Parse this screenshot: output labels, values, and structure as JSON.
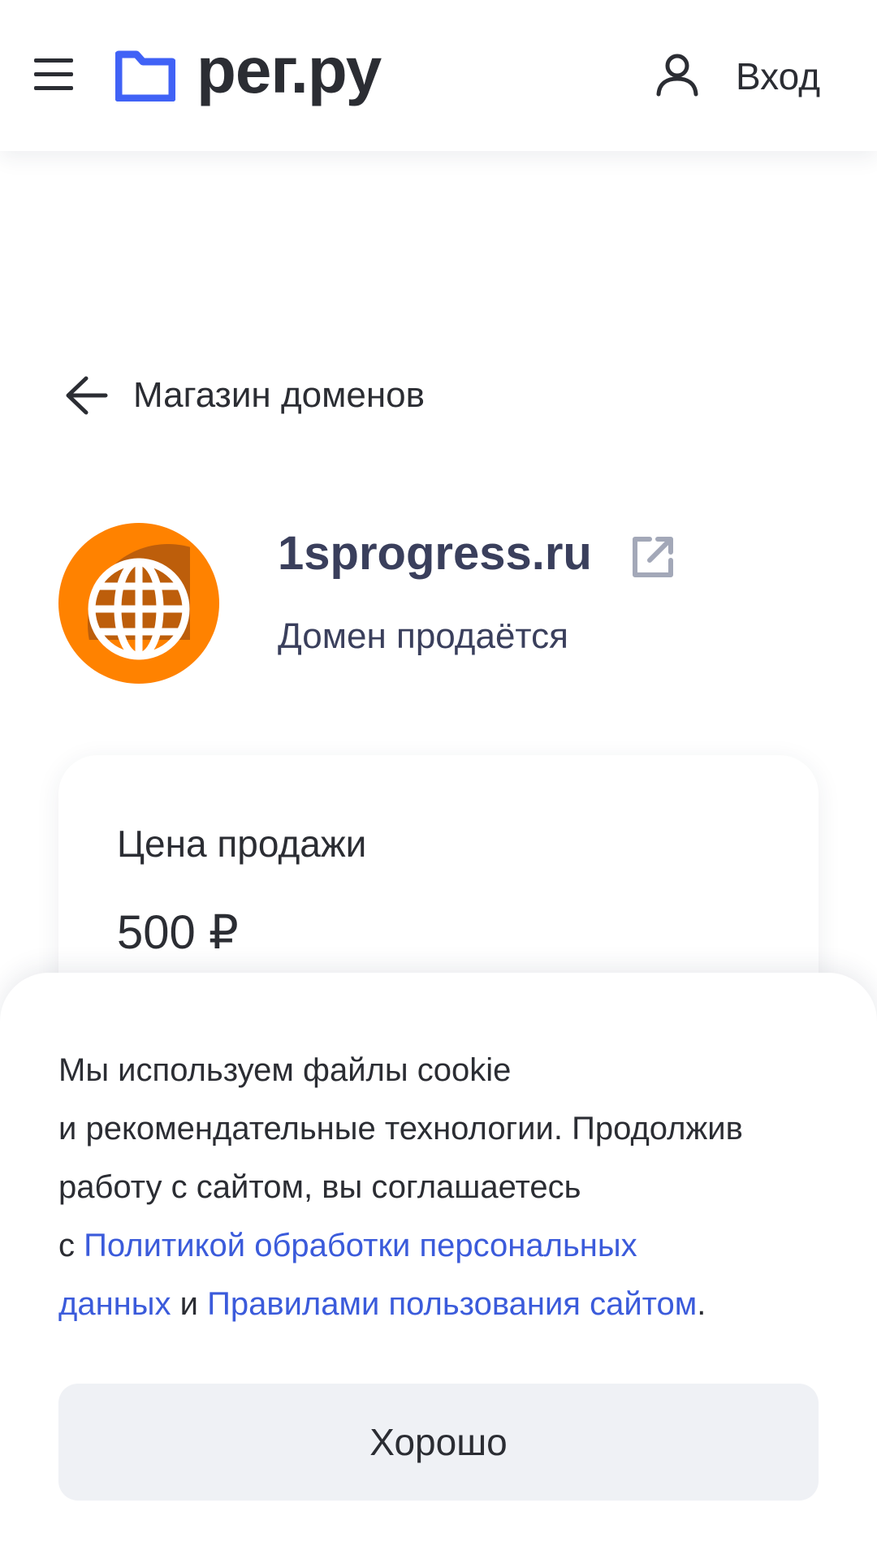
{
  "header": {
    "logo_text": "рег.ру",
    "login_label": "Вход",
    "brand_color": "#4062f6",
    "menu_icon": "hamburger-icon",
    "user_icon": "user-icon"
  },
  "back_link": {
    "label": "Магазин доменов",
    "icon": "arrow-left-icon"
  },
  "domain": {
    "name": "1sprogress.ru",
    "status": "Домен продаётся",
    "avatar_icon": "globe-icon",
    "avatar_color": "#ff8200",
    "external_icon": "external-link-icon"
  },
  "price": {
    "label": "Цена продажи",
    "value": "500 ₽"
  },
  "cookie": {
    "line1": "Мы используем файлы cookie",
    "line2": "и рекомендательные технологии. Продолжив",
    "line3": "работу с сайтом, вы соглашаетесь",
    "prefix": "с ",
    "link1_part1": "Политикой обработки персональных",
    "link1_part2": "данных",
    "conjunction": " и ",
    "link2": "Правилами пользования сайтом",
    "suffix": ".",
    "ok_label": "Хорошо",
    "link_color": "#3b5bdb"
  }
}
